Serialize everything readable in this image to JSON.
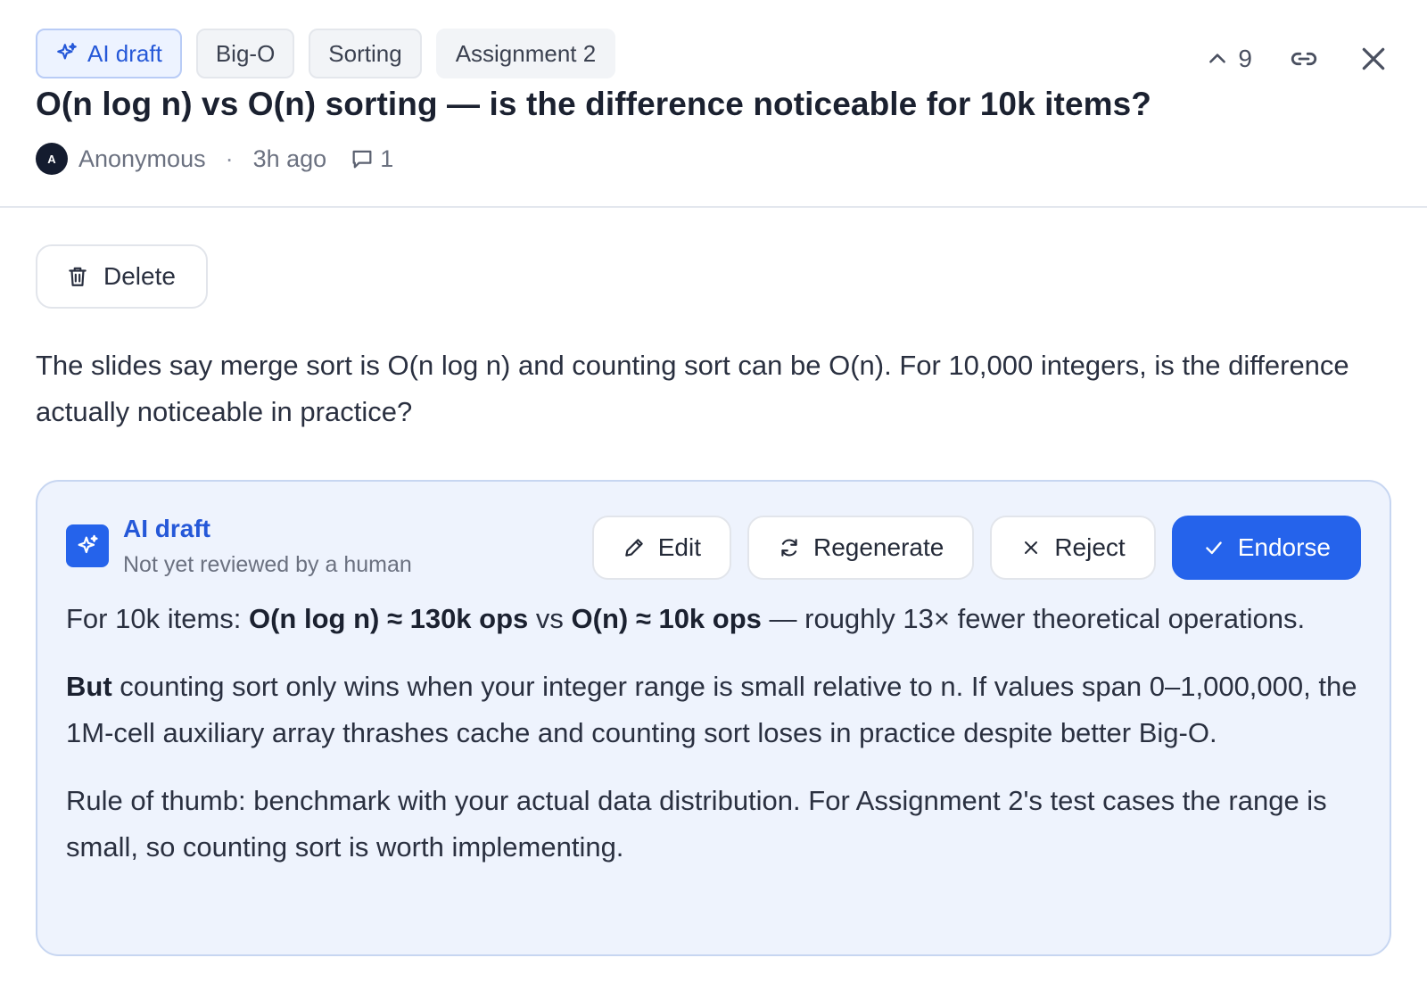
{
  "tags": [
    {
      "label": "AI draft",
      "icon": "sparkle-icon"
    },
    {
      "label": "Big-O"
    },
    {
      "label": "Sorting"
    },
    {
      "label": "Assignment 2"
    }
  ],
  "vote": {
    "count": "9"
  },
  "post": {
    "title": "O(n log n) vs O(n) sorting — is the difference noticeable for 10k items?",
    "author_initial": "A",
    "author": "Anonymous",
    "separator": "·",
    "time": "3h ago",
    "reply_count": "1",
    "delete_label": "Delete",
    "body": "The slides say merge sort is O(n log n) and counting sort can be O(n). For 10,000 integers, is the difference actually noticeable in practice?"
  },
  "ai_draft": {
    "title": "AI draft",
    "subtitle": "Not yet reviewed by a human",
    "actions": {
      "edit": "Edit",
      "regenerate": "Regenerate",
      "reject": "Reject",
      "endorse": "Endorse"
    },
    "p1": {
      "prefix": "For 10k items: ",
      "b1": "O(n log n) ≈ 130k ops",
      "mid": " vs ",
      "b2": "O(n) ≈ 10k ops",
      "suffix": " — roughly 13× fewer theoretical operations."
    },
    "p2": {
      "bold": "But",
      "rest": " counting sort only wins when your integer range is small relative to n. If values span 0–1,000,000, the 1M-cell auxiliary array thrashes cache and counting sort loses in practice despite better Big-O."
    },
    "p3": "Rule of thumb: benchmark with your actual data distribution. For Assignment 2's test cases the range is small, so counting sort is worth implementing."
  },
  "colors": {
    "accent": "#2563eb",
    "ai_bg": "#eef3fd",
    "avatar": "#141c2f"
  }
}
